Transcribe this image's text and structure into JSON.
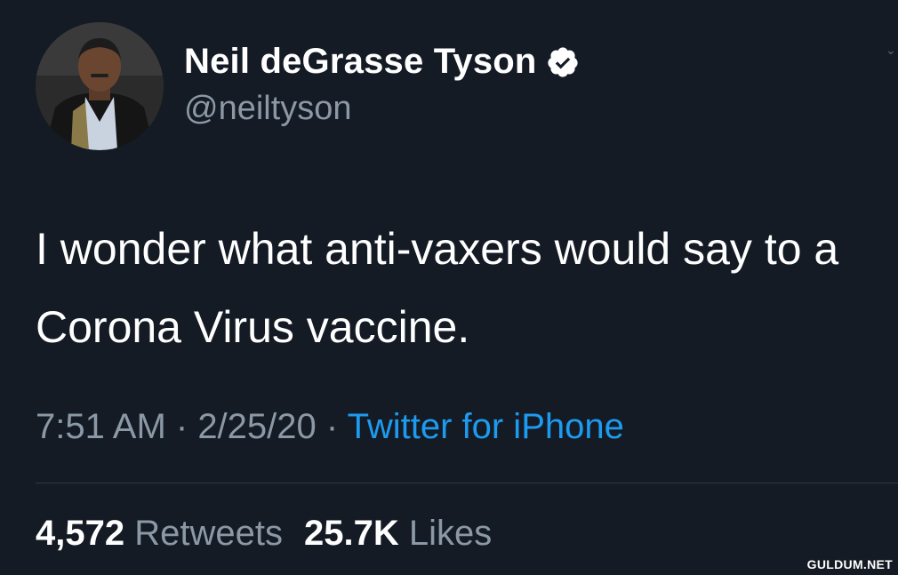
{
  "author": {
    "display_name": "Neil deGrasse Tyson",
    "handle": "@neiltyson",
    "verified": true,
    "avatar_icon": "profile-photo"
  },
  "tweet": {
    "text": "I wonder what anti-vaxers would say to a Corona Virus vaccine.",
    "time": "7:51 AM",
    "separator_1": " · ",
    "date": "2/25/20",
    "separator_2": " · ",
    "source": "Twitter for iPhone"
  },
  "stats": {
    "retweets_count": "4,572",
    "retweets_label": "Retweets",
    "likes_count": "25.7K",
    "likes_label": "Likes"
  },
  "watermark": "GULDUM.NET",
  "colors": {
    "background": "#141b24",
    "primary_text": "#ffffff",
    "secondary_text": "#8b98a5",
    "link": "#1d9bf0"
  }
}
